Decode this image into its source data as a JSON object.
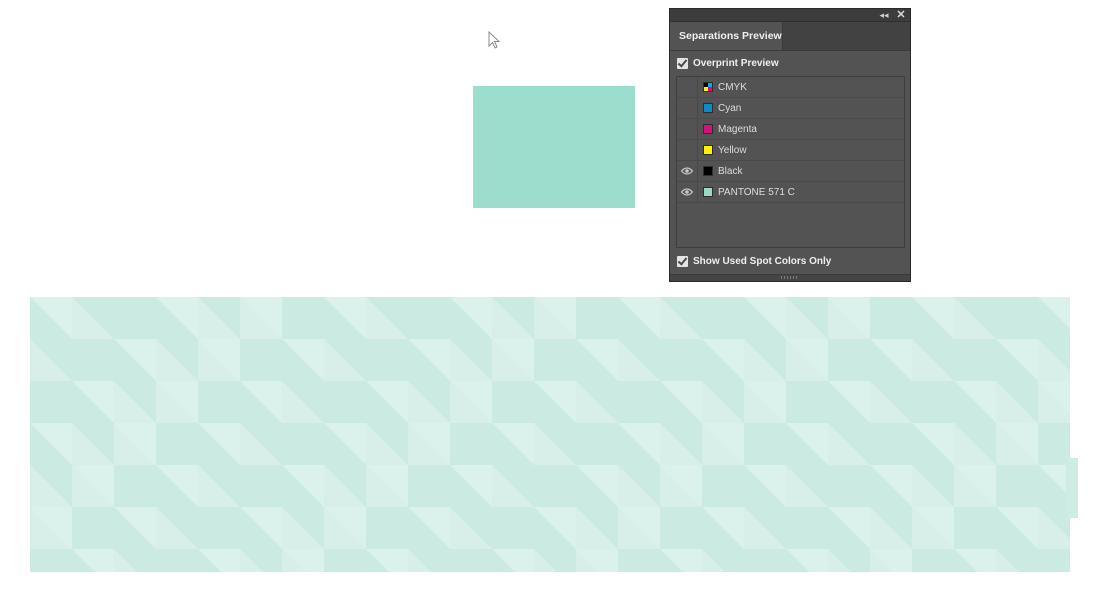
{
  "panel": {
    "title": "Separations Preview",
    "overprint_preview": {
      "label": "Overprint Preview",
      "checked": true
    },
    "show_used_spot_only": {
      "label": "Show Used Spot Colors Only",
      "checked": true
    },
    "plates": [
      {
        "name": "CMYK",
        "color": "cmyk",
        "visible": false
      },
      {
        "name": "Cyan",
        "color": "#0d8bc8",
        "visible": false
      },
      {
        "name": "Magenta",
        "color": "#cf1479",
        "visible": false
      },
      {
        "name": "Yellow",
        "color": "#fff200",
        "visible": false
      },
      {
        "name": "Black",
        "color": "#000000",
        "visible": true
      },
      {
        "name": "PANTONE 571 C",
        "color": "#9bd8c7",
        "visible": true
      }
    ],
    "icons": {
      "collapse": "double-chevron-left-icon",
      "close": "close-icon",
      "eye": "eye-icon"
    }
  },
  "artwork": {
    "rect_color": "#9bdecd",
    "pattern_base_color": "#cfece4",
    "pattern_light_color": "#e6f5f1",
    "pattern_dark_color": "#bfe5da"
  }
}
